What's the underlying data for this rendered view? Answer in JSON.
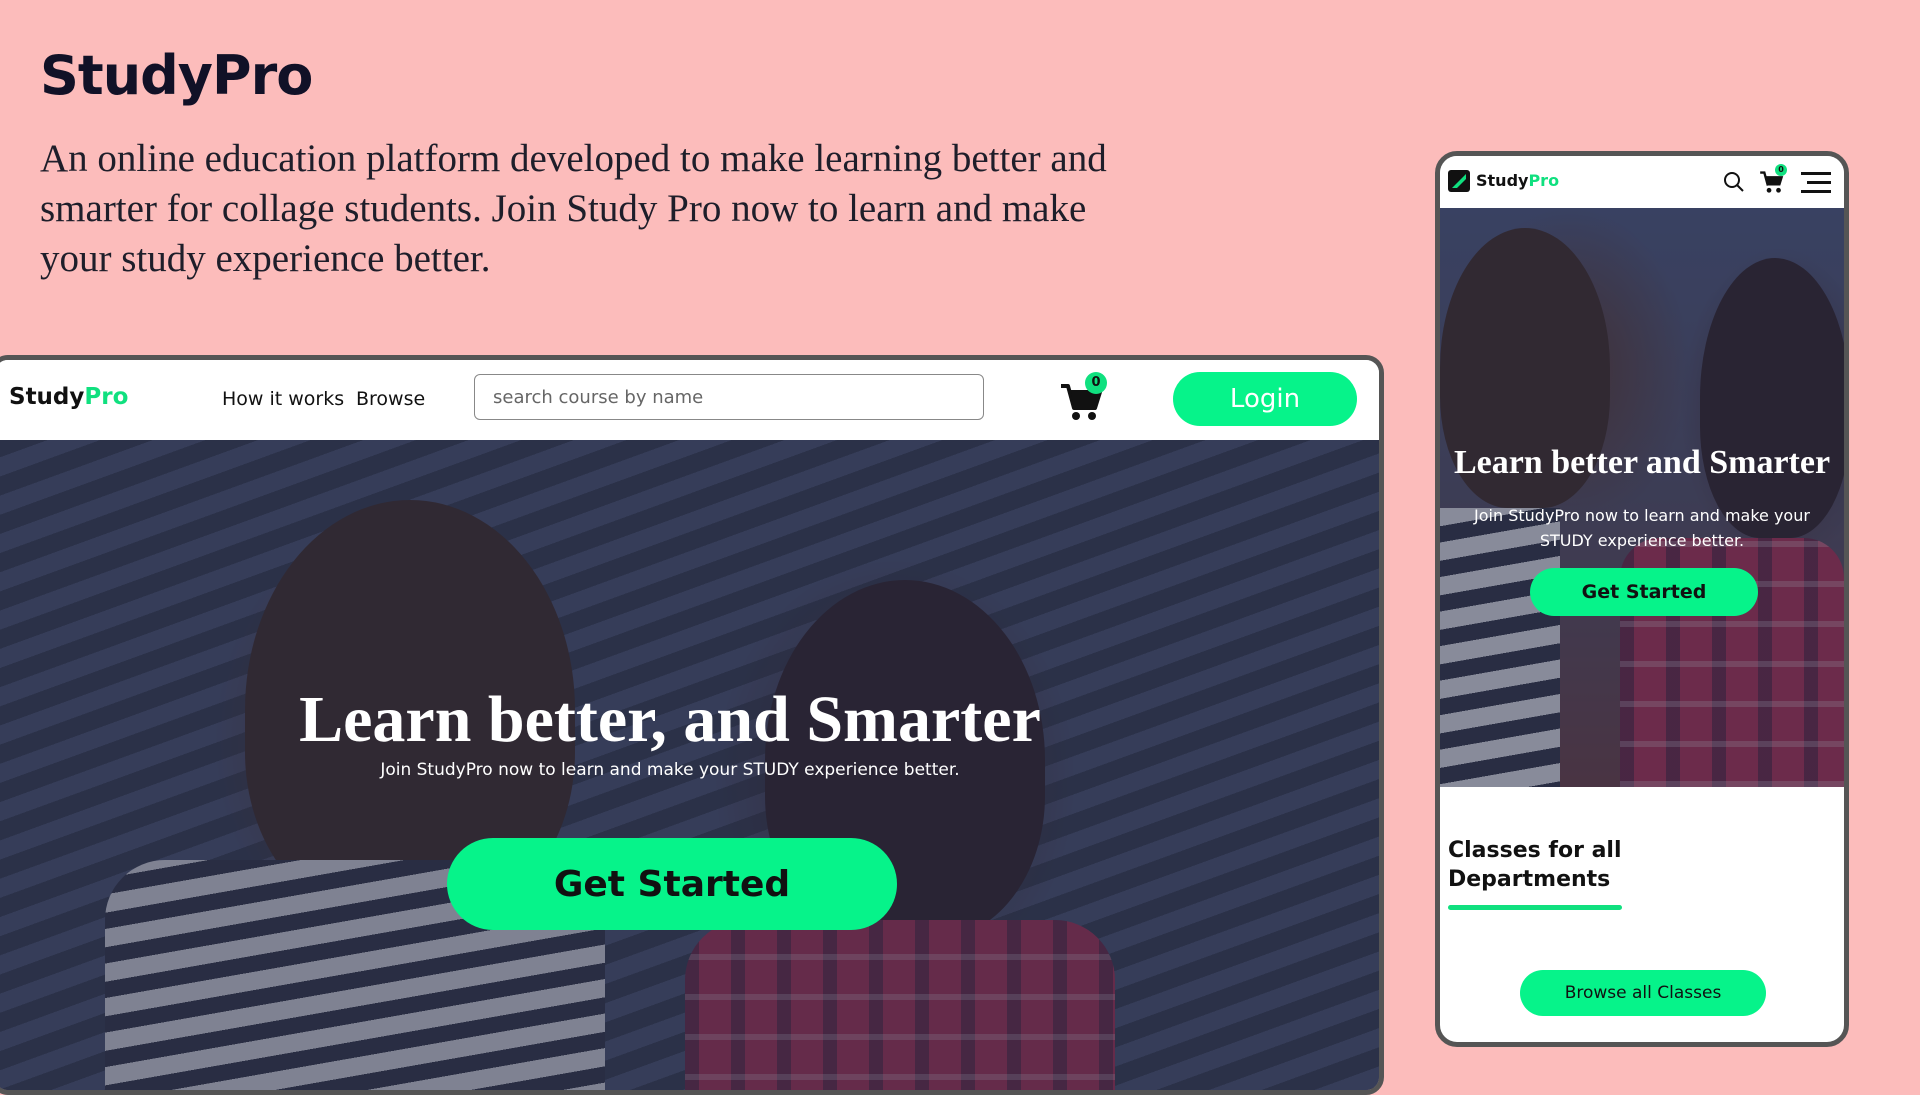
{
  "header": {
    "title": "StudyPro",
    "description": "An online education platform developed to make learning better and smarter for collage students. Join Study Pro now to learn and make your study experience better."
  },
  "desktop": {
    "logo_main": "Study",
    "logo_accent": "Pro",
    "nav_links": [
      "How it works",
      "Browse"
    ],
    "search_placeholder": "search course by name",
    "cart_count": "0",
    "login_label": "Login",
    "hero_title": "Learn better, and Smarter",
    "hero_subtitle": "Join StudyPro now to learn and make your STUDY experience better.",
    "cta_label": "Get Started"
  },
  "mobile": {
    "logo_main": "Study",
    "logo_accent": "Pro",
    "cart_count": "0",
    "hero_title": "Learn better and Smarter",
    "hero_subtitle": "Join StudyPro now to learn and make your STUDY experience better.",
    "cta_label": "Get Started",
    "section_title": "Classes for all Departments",
    "browse_label": "Browse all Classes"
  },
  "colors": {
    "background": "#fcbcbb",
    "accent": "#06f38a",
    "text_dark": "#111127"
  },
  "icons": [
    "cart-icon",
    "search-icon",
    "menu-icon",
    "logo-mark-icon"
  ]
}
